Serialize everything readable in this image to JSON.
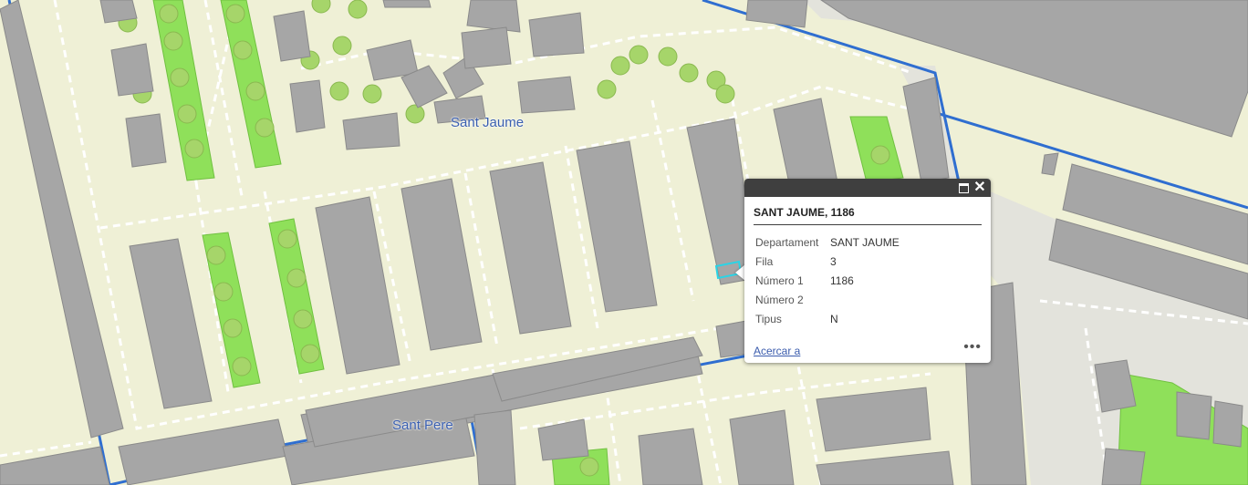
{
  "map": {
    "labels": [
      "Sant Jaume",
      "Sant Pere"
    ]
  },
  "popup": {
    "title": "SANT JAUME, 1186",
    "maximize_icon": "maximize-icon",
    "close_icon": "close-icon",
    "fields": [
      {
        "label": "Departament",
        "value": "SANT JAUME"
      },
      {
        "label": "Fila",
        "value": "3"
      },
      {
        "label": "Número 1",
        "value": "1186"
      },
      {
        "label": "Número 2",
        "value": ""
      },
      {
        "label": "Tipus",
        "value": "N"
      }
    ],
    "zoom_link": "Acercar a",
    "more_label": "•••"
  },
  "colors": {
    "background": "#eff0d6",
    "building": "#a6a6a6",
    "green": "#8fe05a",
    "path": "#ffffff",
    "boundary": "#2f6ed0",
    "selection": "#2ad4e6"
  }
}
